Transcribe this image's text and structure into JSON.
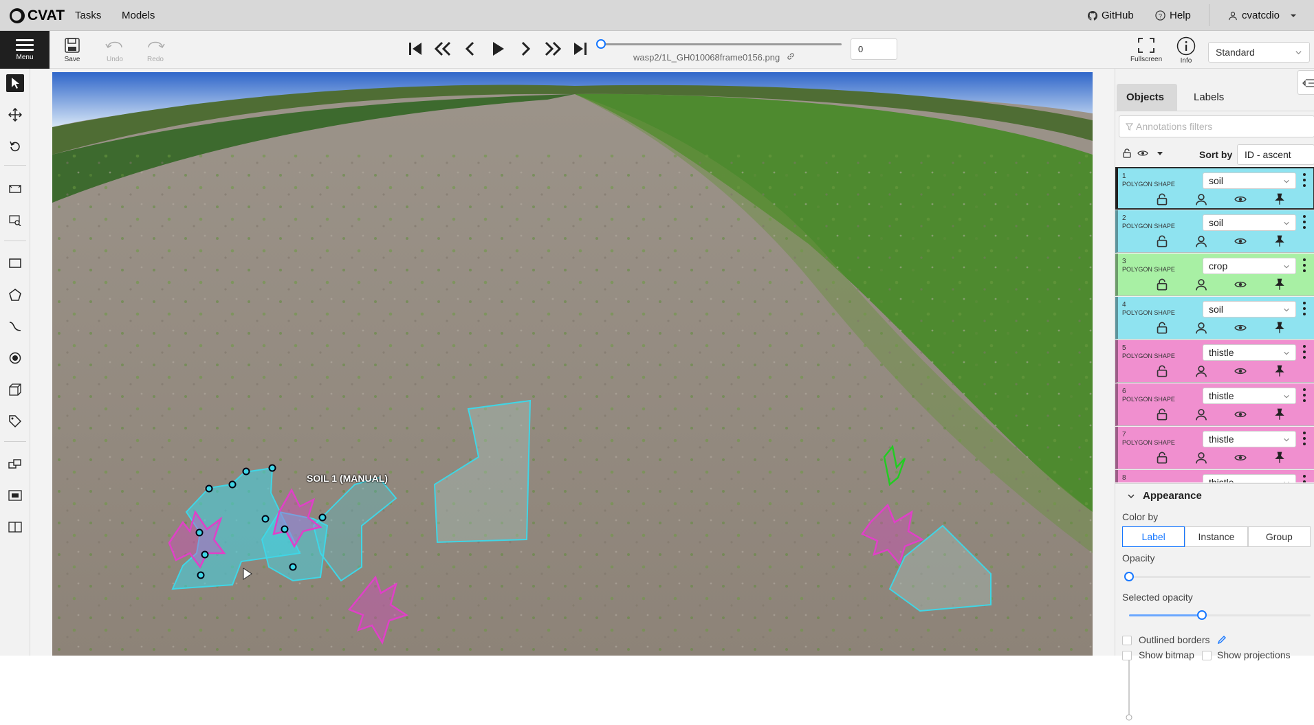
{
  "brand": {
    "name": "CVAT"
  },
  "nav": {
    "tasks": "Tasks",
    "models": "Models",
    "github": "GitHub",
    "help": "Help",
    "user": "cvatcdio"
  },
  "toolbar": {
    "menu": "Menu",
    "save": "Save",
    "undo": "Undo",
    "redo": "Redo",
    "fullscreen": "Fullscreen",
    "info": "Info"
  },
  "player": {
    "filename": "wasp2/1L_GH010068frame0156.png",
    "frame": "0",
    "progress": 0
  },
  "workspace": {
    "selected": "Standard"
  },
  "canvas": {
    "selected_label": "SOIL 1 (MANUAL)"
  },
  "sidebar": {
    "tabs": [
      "Objects",
      "Labels"
    ],
    "filter_placeholder": "Annotations filters",
    "sort_label": "Sort by",
    "sort_value": "ID - ascent",
    "objects": [
      {
        "id": "1",
        "type": "POLYGON SHAPE",
        "label": "soil",
        "color": "#8fe3f0"
      },
      {
        "id": "2",
        "type": "POLYGON SHAPE",
        "label": "soil",
        "color": "#8fe3f0"
      },
      {
        "id": "3",
        "type": "POLYGON SHAPE",
        "label": "crop",
        "color": "#a8f0a4"
      },
      {
        "id": "4",
        "type": "POLYGON SHAPE",
        "label": "soil",
        "color": "#8fe3f0"
      },
      {
        "id": "5",
        "type": "POLYGON SHAPE",
        "label": "thistle",
        "color": "#f08fcf"
      },
      {
        "id": "6",
        "type": "POLYGON SHAPE",
        "label": "thistle",
        "color": "#f08fcf"
      },
      {
        "id": "7",
        "type": "POLYGON SHAPE",
        "label": "thistle",
        "color": "#f08fcf"
      },
      {
        "id": "8",
        "type": "POLYGON SHAPE",
        "label": "thistle",
        "color": "#f08fcf"
      }
    ]
  },
  "appearance": {
    "title": "Appearance",
    "color_by": "Color by",
    "color_by_options": [
      "Label",
      "Instance",
      "Group"
    ],
    "color_by_selected": "Label",
    "opacity": "Opacity",
    "opacity_value": 0,
    "selected_opacity": "Selected opacity",
    "selected_opacity_value": 0.4,
    "outlined_borders": "Outlined borders",
    "show_bitmap": "Show bitmap",
    "show_projections": "Show projections"
  },
  "colors": {
    "accent": "#1677ff",
    "soil": "#3fd6e6",
    "thistle": "#e040c8",
    "crop": "#22cc22"
  }
}
